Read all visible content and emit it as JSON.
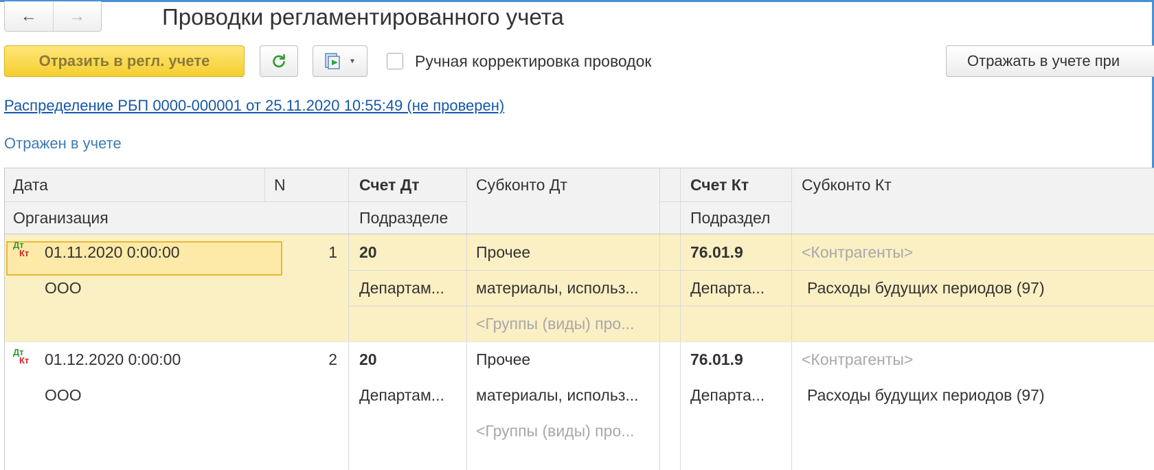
{
  "header": {
    "back_icon": "arrow-left-icon",
    "forward_icon": "arrow-right-icon",
    "title": "Проводки регламентированного учета"
  },
  "toolbar": {
    "primary_label": "Отразить в регл. учете",
    "refresh_icon": "refresh-icon",
    "post_icon": "document-post-icon",
    "manual_checkbox_label": "Ручная корректировка проводок",
    "manual_checked": false,
    "reflect_label": "Отражать в учете при"
  },
  "document_link": "Распределение РБП 0000-000001 от 25.11.2020 10:55:49 (не проверен)",
  "status": "Отражен в учете",
  "table": {
    "headers": {
      "date": "Дата",
      "n": "N",
      "account_dt": "Счет Дт",
      "subconto_dt": "Субконто Дт",
      "account_kt": "Счет Кт",
      "subconto_kt": "Субконто Кт",
      "organization": "Организация",
      "division_dt": "Подразделе",
      "division_kt": "Подраздел"
    },
    "rows": [
      {
        "date": "01.11.2020 0:00:00",
        "n": "1",
        "account_dt": "20",
        "subconto_dt_1": "Прочее",
        "subconto_dt_2": "материалы, использ...",
        "subconto_dt_3": "<Группы (виды) про...",
        "account_kt": "76.01.9",
        "subconto_kt_1": "<Контрагенты>",
        "subconto_kt_2": "Расходы будущих периодов (97)",
        "organization": "ООО",
        "division_dt": "Департам...",
        "division_kt": "Департа..."
      },
      {
        "date": "01.12.2020 0:00:00",
        "n": "2",
        "account_dt": "20",
        "subconto_dt_1": "Прочее",
        "subconto_dt_2": "материалы, использ...",
        "subconto_dt_3": "<Группы (виды) про...",
        "account_kt": "76.01.9",
        "subconto_kt_1": "<Контрагенты>",
        "subconto_kt_2": "Расходы будущих периодов (97)",
        "organization": "ООО",
        "division_dt": "Департам...",
        "division_kt": "Департа..."
      }
    ],
    "row_icon_dt": "Дт",
    "row_icon_kt": "Кт"
  },
  "colors": {
    "primary_button": "#f5cf2f",
    "selected_row": "#fbefc4",
    "link": "#1557a8",
    "frame": "#4a8fd6",
    "dt_icon": "#2e9b2e",
    "kt_icon": "#d02626"
  }
}
